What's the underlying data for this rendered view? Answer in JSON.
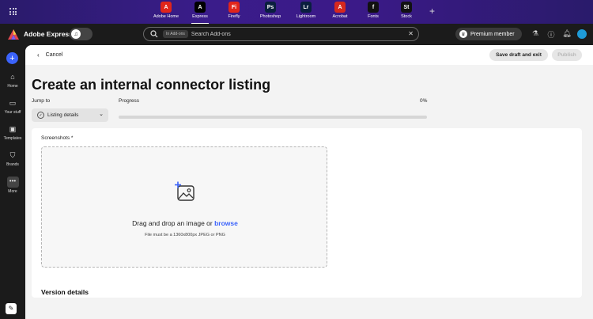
{
  "top_bar": {
    "apps": [
      {
        "label": "Adobe Home",
        "glyph": "A",
        "color": "#e1251b",
        "active": false
      },
      {
        "label": "Express",
        "glyph": "A",
        "color": "#000000",
        "active": true
      },
      {
        "label": "Firefly",
        "glyph": "Fi",
        "color": "#e1251b",
        "active": false
      },
      {
        "label": "Photoshop",
        "glyph": "Ps",
        "color": "#0a1f3f",
        "active": false
      },
      {
        "label": "Lightroom",
        "glyph": "Lr",
        "color": "#0a1f3f",
        "active": false
      },
      {
        "label": "Acrobat",
        "glyph": "A",
        "color": "#d7281e",
        "active": false
      },
      {
        "label": "Fonts",
        "glyph": "f",
        "color": "#111111",
        "active": false
      },
      {
        "label": "Stock",
        "glyph": "St",
        "color": "#111111",
        "active": false
      }
    ]
  },
  "header": {
    "brand": "Adobe Express",
    "search_chip": "In Add-ons",
    "search_placeholder": "Search Add-ons",
    "premium_label": "Premium member"
  },
  "rail": {
    "items": [
      {
        "label": "Home",
        "icon": "home-icon"
      },
      {
        "label": "Your stuff",
        "icon": "folder-icon"
      },
      {
        "label": "Templates",
        "icon": "templates-icon"
      },
      {
        "label": "Brands",
        "icon": "brands-icon"
      },
      {
        "label": "More",
        "icon": "more-icon"
      }
    ]
  },
  "toolbar": {
    "cancel_label": "Cancel",
    "save_label": "Save draft and exit",
    "publish_label": "Publish"
  },
  "page": {
    "title": "Create an internal connector listing",
    "jump_label": "Jump to",
    "jump_value": "Listing details",
    "progress_label": "Progress",
    "progress_value": "0%",
    "progress_fraction": 0
  },
  "form": {
    "screenshots_label": "Screenshots *",
    "drop_text": "Drag and drop an image or",
    "browse_text": "browse",
    "drop_hint": "File must be a 1360x800px JPEG or PNG",
    "version_heading": "Version details"
  },
  "colors": {
    "accent": "#3b63fb"
  }
}
